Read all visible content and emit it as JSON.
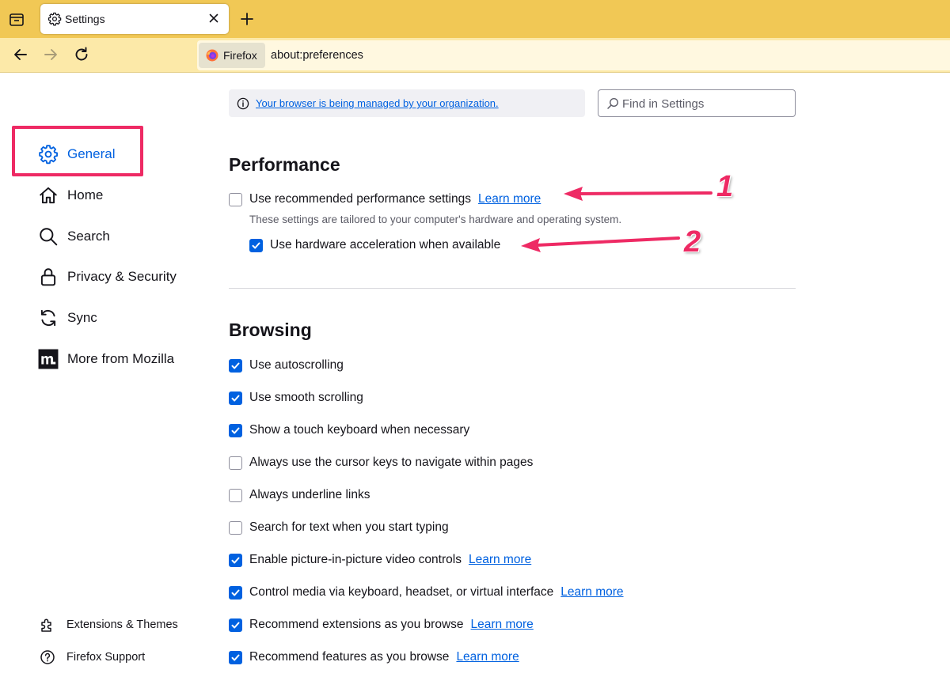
{
  "tabs": [
    {
      "title": "Settings",
      "active": true
    }
  ],
  "urlbar": {
    "identity_label": "Firefox",
    "url": "about:preferences"
  },
  "sidebar": {
    "categories": [
      {
        "label": "General",
        "icon": "gear-icon",
        "selected": true
      },
      {
        "label": "Home",
        "icon": "home-icon"
      },
      {
        "label": "Search",
        "icon": "search-icon"
      },
      {
        "label": "Privacy & Security",
        "icon": "lock-icon"
      },
      {
        "label": "Sync",
        "icon": "sync-icon"
      },
      {
        "label": "More from Mozilla",
        "icon": "mozilla-m-icon"
      }
    ],
    "footer": [
      {
        "label": "Extensions & Themes",
        "icon": "puzzle-icon"
      },
      {
        "label": "Firefox Support",
        "icon": "help-icon"
      }
    ]
  },
  "policies_notice": "Your browser is being managed by your organization.",
  "search": {
    "placeholder": "Find in Settings",
    "value": ""
  },
  "performance": {
    "heading": "Performance",
    "recommended": {
      "label": "Use recommended performance settings",
      "checked": false,
      "learn_more": "Learn more"
    },
    "description": "These settings are tailored to your computer's hardware and operating system.",
    "hardware_accel": {
      "label": "Use hardware acceleration when available",
      "checked": true
    }
  },
  "browsing": {
    "heading": "Browsing",
    "options": [
      {
        "label": "Use autoscrolling",
        "checked": true
      },
      {
        "label": "Use smooth scrolling",
        "checked": true
      },
      {
        "label": "Show a touch keyboard when necessary",
        "checked": true
      },
      {
        "label": "Always use the cursor keys to navigate within pages",
        "checked": false
      },
      {
        "label": "Always underline links",
        "checked": false
      },
      {
        "label": "Search for text when you start typing",
        "checked": false
      },
      {
        "label": "Enable picture-in-picture video controls",
        "checked": true,
        "learn_more": "Learn more"
      },
      {
        "label": "Control media via keyboard, headset, or virtual interface",
        "checked": true,
        "learn_more": "Learn more"
      },
      {
        "label": "Recommend extensions as you browse",
        "checked": true,
        "learn_more": "Learn more"
      },
      {
        "label": "Recommend features as you browse",
        "checked": true,
        "learn_more": "Learn more"
      }
    ]
  },
  "annotations": {
    "marker_1": "1",
    "marker_2": "2",
    "color": "#ee2a64"
  },
  "colors": {
    "tabbar": "#f1c855",
    "navbar": "#fce9a8",
    "accent": "#0061e0"
  }
}
